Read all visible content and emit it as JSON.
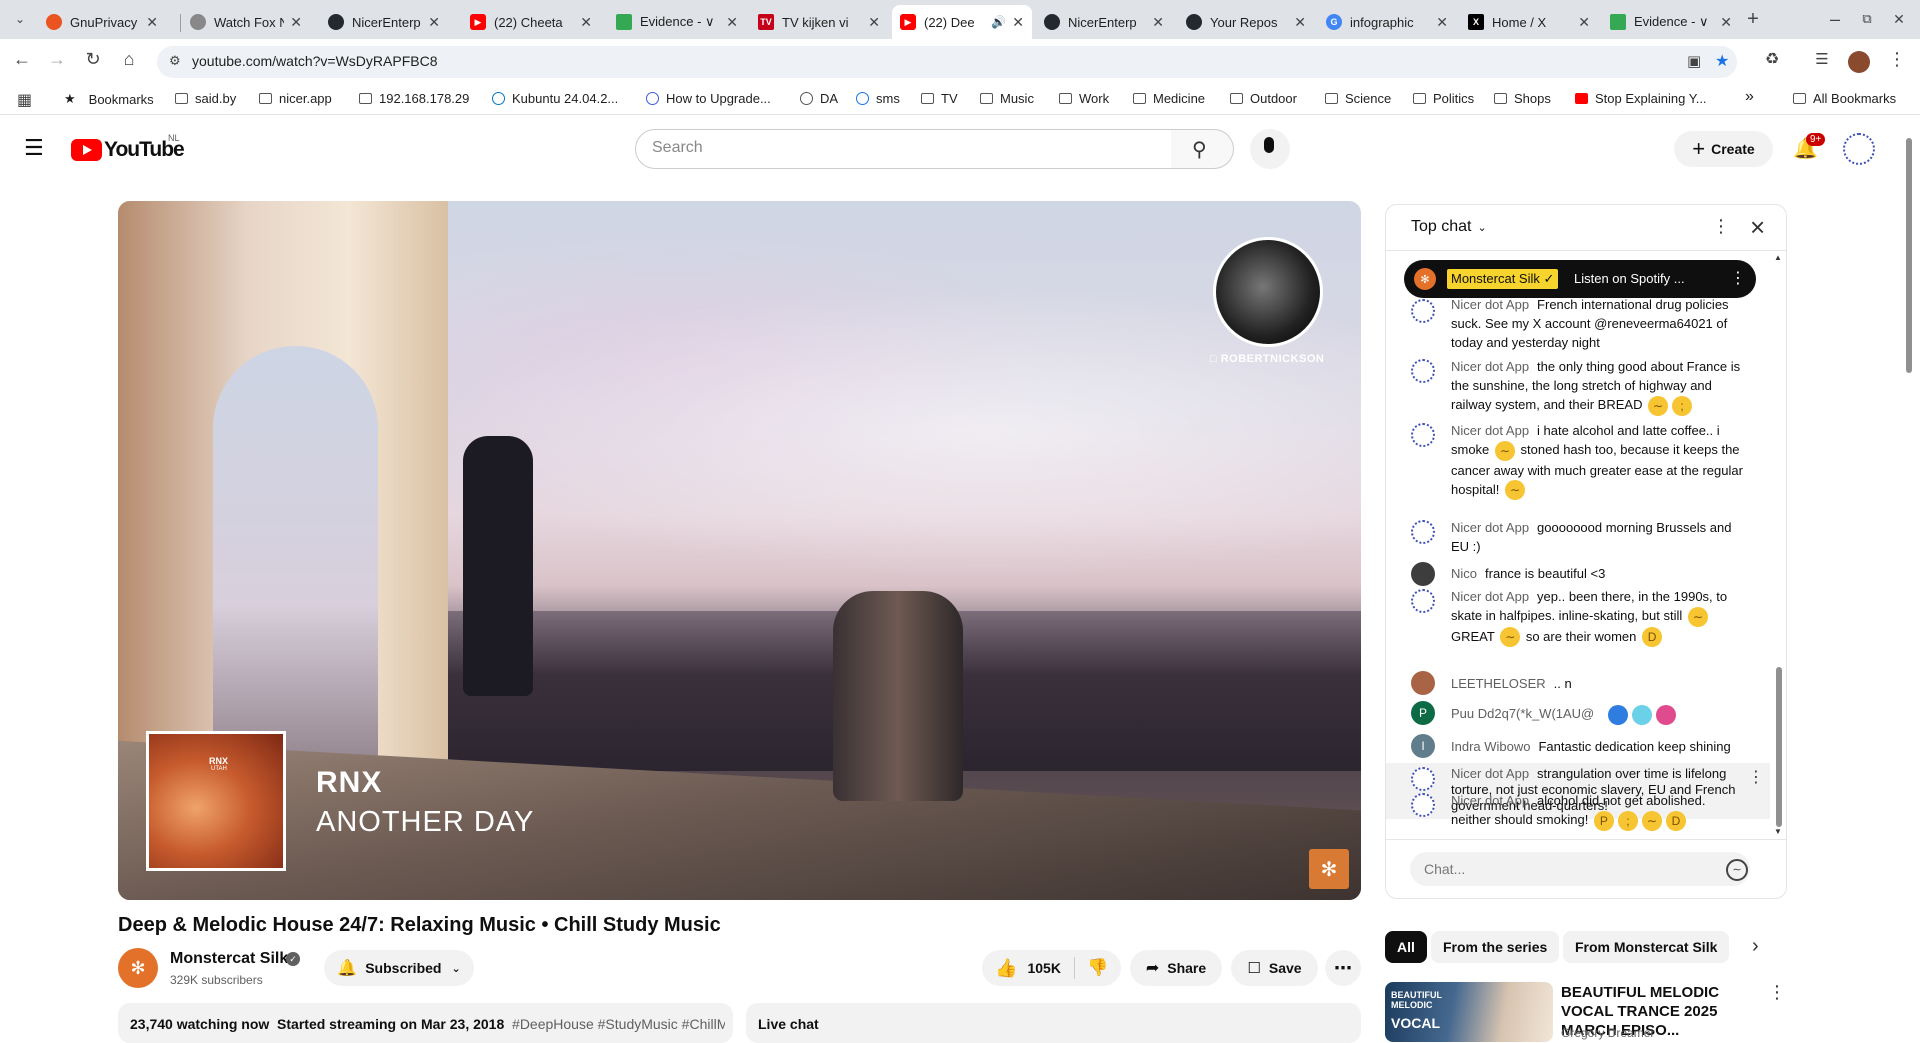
{
  "browser": {
    "tabs": [
      {
        "title": "GnuPrivacy",
        "fav_color": "#e95420",
        "active": false
      },
      {
        "title": "Watch Fox N",
        "fav_color": "#888888",
        "active": false
      },
      {
        "title": "NicerEnterp",
        "fav_color": "#24292f",
        "active": false
      },
      {
        "title": "(22) Cheeta",
        "fav_color": "#ff0000",
        "active": false
      },
      {
        "title": "Evidence - ∨",
        "fav_color": "#34a853",
        "active": false
      },
      {
        "title": "TV kijken vi",
        "fav_color": "#c4001a",
        "active": false
      },
      {
        "title": "(22) Dee",
        "fav_color": "#ff0000",
        "active": true
      },
      {
        "title": "NicerEnterp",
        "fav_color": "#24292f",
        "active": false
      },
      {
        "title": "Your Repos",
        "fav_color": "#24292f",
        "active": false
      },
      {
        "title": "infographic",
        "fav_color": "#4285f4",
        "active": false
      },
      {
        "title": "Home / X",
        "fav_color": "#000000",
        "active": false
      },
      {
        "title": "Evidence - ∨",
        "fav_color": "#34a853",
        "active": false
      }
    ],
    "url": "youtube.com/watch?v=WsDyRAPFBC8",
    "bookmarks": [
      {
        "label": "Bookmarks",
        "icon": "star-icon"
      },
      {
        "label": "said.by",
        "icon": "folder-icon"
      },
      {
        "label": "nicer.app",
        "icon": "folder-icon"
      },
      {
        "label": "192.168.178.29",
        "icon": "folder-icon"
      },
      {
        "label": "Kubuntu 24.04.2...",
        "icon": "kubuntu-icon"
      },
      {
        "label": "How to Upgrade...",
        "icon": "site-icon"
      },
      {
        "label": "DA",
        "icon": "github-icon"
      },
      {
        "label": "sms",
        "icon": "sms-icon"
      },
      {
        "label": "TV",
        "icon": "folder-icon"
      },
      {
        "label": "Music",
        "icon": "folder-icon"
      },
      {
        "label": "Work",
        "icon": "folder-icon"
      },
      {
        "label": "Medicine",
        "icon": "folder-icon"
      },
      {
        "label": "Outdoor",
        "icon": "folder-icon"
      },
      {
        "label": "Science",
        "icon": "folder-icon"
      },
      {
        "label": "Politics",
        "icon": "folder-icon"
      },
      {
        "label": "Shops",
        "icon": "folder-icon"
      },
      {
        "label": "Stop Explaining Y...",
        "icon": "youtube-icon"
      }
    ],
    "more_bookmarks": "»",
    "all_bookmarks": "All Bookmarks"
  },
  "masthead": {
    "logo_text": "YouTube",
    "country_code": "NL",
    "search_placeholder": "Search",
    "create_label": "Create",
    "notification_count": "9+"
  },
  "player": {
    "artist_handle": "ROBERTNICKSON",
    "artist": "RNX",
    "song": "ANOTHER DAY",
    "album_label": "RNX",
    "album_sub": "UTAH"
  },
  "video": {
    "title": "Deep & Melodic House 24/7: Relaxing Music • Chill Study Music",
    "channel": "Monstercat Silk",
    "subscribers": "329K subscribers",
    "subscribed_label": "Subscribed",
    "likes": "105K",
    "share_label": "Share",
    "save_label": "Save",
    "watching": "23,740 watching now",
    "started": "Started streaming on Mar 23, 2018",
    "hashtags": "#DeepHouse #StudyMusic #ChillM",
    "live_chat_label": "Live chat"
  },
  "chat": {
    "title": "Top chat",
    "pinned_badge": "Monstercat Silk ✓",
    "pinned_text": "Listen on Spotify ...",
    "input_placeholder": "Chat...",
    "messages": [
      {
        "author": "Nicer dot App",
        "text": "French international drug policies suck. See my X account @reneveerma64021 of today and yesterday night",
        "avatar": "nicer"
      },
      {
        "author": "Nicer dot App",
        "text": "the only thing good about France is the sunshine, the long stretch of highway and railway system, and their BREAD",
        "avatar": "nicer",
        "emojis": [
          "slightly-smiling-face",
          "winking-face"
        ]
      },
      {
        "author": "Nicer dot App",
        "text": "i hate alcohol and latte coffee.. i smoke",
        "text2": "stoned hash too, because it keeps the cancer away with much greater ease at the regular hospital!",
        "avatar": "nicer"
      },
      {
        "author": "Nicer dot App",
        "text": "goooooood morning Brussels and EU :)",
        "avatar": "nicer"
      },
      {
        "author": "Nico",
        "text": "france is beautiful <3",
        "avatar": "nico"
      },
      {
        "author": "Nicer dot App",
        "text": "yep.. been there, in the 1990s, to skate in halfpipes. inline-skating, but still",
        "text2": "GREAT",
        "text3": "so are their women",
        "avatar": "nicer"
      },
      {
        "author": "LEETHELOSER",
        "text": ".. n",
        "avatar": "leet"
      },
      {
        "author": "Puu Dd2q7(*k_W(1AU@",
        "text": "",
        "avatar": "puu",
        "initial": "P"
      },
      {
        "author": "Indra Wibowo",
        "text": "Fantastic dedication keep shining",
        "avatar": "indra",
        "initial": "I"
      },
      {
        "author": "Nicer dot App",
        "text": "strangulation over time is lifelong torture, not just economic slavery, EU and French government head-quarters!",
        "avatar": "nicer"
      },
      {
        "author": "Nicer dot App",
        "text": "alcohol did not get abolished. neither should smoking!",
        "avatar": "nicer"
      }
    ]
  },
  "recommendations": {
    "chips": [
      "All",
      "From the series",
      "From Monstercat Silk"
    ],
    "item": {
      "title": "BEAUTIFUL MELODIC VOCAL TRANCE 2025 MARCH EPISO...",
      "channel": "Gregory Dreamer",
      "thumb_text": "BEAUTIFUL MELODIC",
      "thumb_big": "VOCAL"
    }
  },
  "colors": {
    "youtube_red": "#ff0000",
    "monstercat_orange": "#e3712a",
    "pinned_badge": "#f6d32d"
  }
}
